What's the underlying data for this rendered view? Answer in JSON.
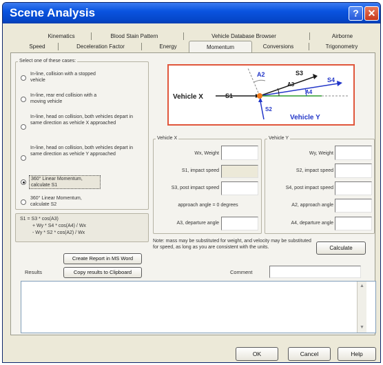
{
  "window": {
    "title": "Scene Analysis",
    "help_glyph": "?",
    "close_glyph": "✕"
  },
  "tabs": {
    "row1": [
      "Kinematics",
      "Blood Stain Pattern",
      "Vehicle Database Browser",
      "Airborne"
    ],
    "row2": [
      "Speed",
      "Deceleration Factor",
      "Energy",
      "Momentum",
      "Conversions",
      "Trigonometry"
    ],
    "active": "Momentum"
  },
  "cases": {
    "title": "Select one of these cases:",
    "options": [
      "In-line, collision with a stopped vehicle",
      "In-line, rear end collision with a moving vehicle",
      "In-line, head on collision, both vehicles depart in same direction as vehicle X approached",
      "In-line, head on collision, both vehicles depart in same direction as vehicle Y approached",
      "360° Linear Momentum, calculate S1",
      "360° Linear Momentum, calculate S2"
    ],
    "selected_index": 4
  },
  "formula": {
    "line1": "S1 = S3 * cos(A3)",
    "line2": "+ Wy * S4 * cos(A4) / Wx",
    "line3": "- Wy * S2 * cos(A2) / Wx"
  },
  "diagram": {
    "vehicle_x": "Vehicle X",
    "vehicle_y": "Vehicle Y",
    "s1": "S1",
    "s2": "S2",
    "s3": "S3",
    "s4": "S4",
    "a2": "A2",
    "a3": "A3",
    "a4": "A4"
  },
  "vehicle_x": {
    "title": "Vehicle X",
    "fields": [
      {
        "label": "Wx, Weight",
        "value": "",
        "disabled": false
      },
      {
        "label": "S1, impact speed",
        "value": "",
        "disabled": true
      },
      {
        "label": "S3, post impact speed",
        "value": "",
        "disabled": false
      },
      {
        "label": "approach angle = 0 degrees",
        "value": null,
        "disabled": false
      },
      {
        "label": "A3, departure angle",
        "value": "",
        "disabled": false
      }
    ]
  },
  "vehicle_y": {
    "title": "Vehicle Y",
    "fields": [
      {
        "label": "Wy, Weight",
        "value": ""
      },
      {
        "label": "S2, impact speed",
        "value": ""
      },
      {
        "label": "S4, post impact speed",
        "value": ""
      },
      {
        "label": "A2, approach angle",
        "value": ""
      },
      {
        "label": "A4, departure angle",
        "value": ""
      }
    ]
  },
  "note": "Note: mass may be substituted for weight, and velocity may be substituted for speed, as long as you are consistent with the units.",
  "buttons": {
    "calculate": "Calculate",
    "create_report": "Create Report in MS Word",
    "copy_results": "Copy results to Clipboard",
    "ok": "OK",
    "cancel": "Cancel",
    "help": "Help"
  },
  "results_label": "Results",
  "comment_label": "Comment",
  "comment_value": "",
  "results_text": "",
  "colors": {
    "title_bar": "#0a54e0",
    "diagram_border": "#e0553a",
    "vehicle_x_arrow": "#1a1a1a",
    "vehicle_y_arrow": "#2236c8",
    "impact_point": "#f07a1a",
    "a4_line": "#2a9a2a"
  }
}
